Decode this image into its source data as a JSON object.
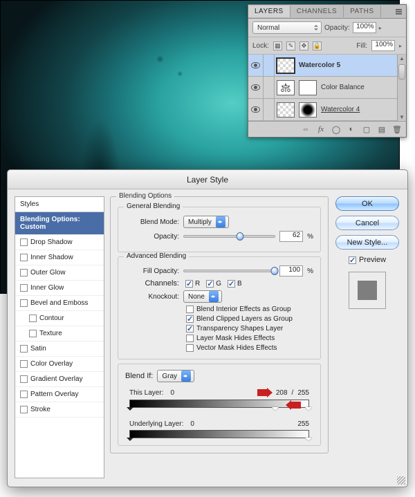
{
  "layers_panel": {
    "tabs": [
      "LAYERS",
      "CHANNELS",
      "PATHS"
    ],
    "blend_mode": "Normal",
    "opacity_label": "Opacity:",
    "opacity_value": "100%",
    "lock_label": "Lock:",
    "fill_label": "Fill:",
    "fill_value": "100%",
    "items": [
      {
        "name": "Watercolor 5",
        "selected": true,
        "bold": true,
        "underline": false,
        "thumb": "trans",
        "mask": false,
        "adj": false
      },
      {
        "name": "Color Balance",
        "selected": false,
        "bold": false,
        "underline": false,
        "thumb": "adj",
        "mask": true,
        "adj": true
      },
      {
        "name": "Watercolor 4",
        "selected": false,
        "bold": false,
        "underline": true,
        "thumb": "trans",
        "mask": true,
        "adj": false
      }
    ]
  },
  "dialog": {
    "title": "Layer Style",
    "styles_header": "Styles",
    "styles": [
      {
        "label": "Blending Options: Custom",
        "selected": true,
        "checkbox": false
      },
      {
        "label": "Drop Shadow",
        "checkbox": true,
        "checked": false
      },
      {
        "label": "Inner Shadow",
        "checkbox": true,
        "checked": false
      },
      {
        "label": "Outer Glow",
        "checkbox": true,
        "checked": false
      },
      {
        "label": "Inner Glow",
        "checkbox": true,
        "checked": false
      },
      {
        "label": "Bevel and Emboss",
        "checkbox": true,
        "checked": false
      },
      {
        "label": "Contour",
        "checkbox": true,
        "checked": false,
        "indent": true
      },
      {
        "label": "Texture",
        "checkbox": true,
        "checked": false,
        "indent": true
      },
      {
        "label": "Satin",
        "checkbox": true,
        "checked": false
      },
      {
        "label": "Color Overlay",
        "checkbox": true,
        "checked": false
      },
      {
        "label": "Gradient Overlay",
        "checkbox": true,
        "checked": false
      },
      {
        "label": "Pattern Overlay",
        "checkbox": true,
        "checked": false
      },
      {
        "label": "Stroke",
        "checkbox": true,
        "checked": false
      }
    ],
    "section_title": "Blending Options",
    "general": {
      "title": "General Blending",
      "blend_mode_label": "Blend Mode:",
      "blend_mode_value": "Multiply",
      "opacity_label": "Opacity:",
      "opacity_value": "62",
      "opacity_suffix": "%"
    },
    "advanced": {
      "title": "Advanced Blending",
      "fill_opacity_label": "Fill Opacity:",
      "fill_opacity_value": "100",
      "fill_opacity_suffix": "%",
      "channels_label": "Channels:",
      "channel_r": "R",
      "channel_g": "G",
      "channel_b": "B",
      "knockout_label": "Knockout:",
      "knockout_value": "None",
      "opts": [
        {
          "label": "Blend Interior Effects as Group",
          "checked": false
        },
        {
          "label": "Blend Clipped Layers as Group",
          "checked": true
        },
        {
          "label": "Transparency Shapes Layer",
          "checked": true
        },
        {
          "label": "Layer Mask Hides Effects",
          "checked": false
        },
        {
          "label": "Vector Mask Hides Effects",
          "checked": false
        }
      ]
    },
    "blendif": {
      "label": "Blend If:",
      "mode": "Gray",
      "this_layer_label": "This Layer:",
      "this_black": "0",
      "this_white_split": "208",
      "this_white_sep": "/",
      "this_white": "255",
      "underlying_label": "Underlying Layer:",
      "under_black": "0",
      "under_white": "255"
    },
    "buttons": {
      "ok": "OK",
      "cancel": "Cancel",
      "new_style": "New Style..."
    },
    "preview_label": "Preview"
  }
}
